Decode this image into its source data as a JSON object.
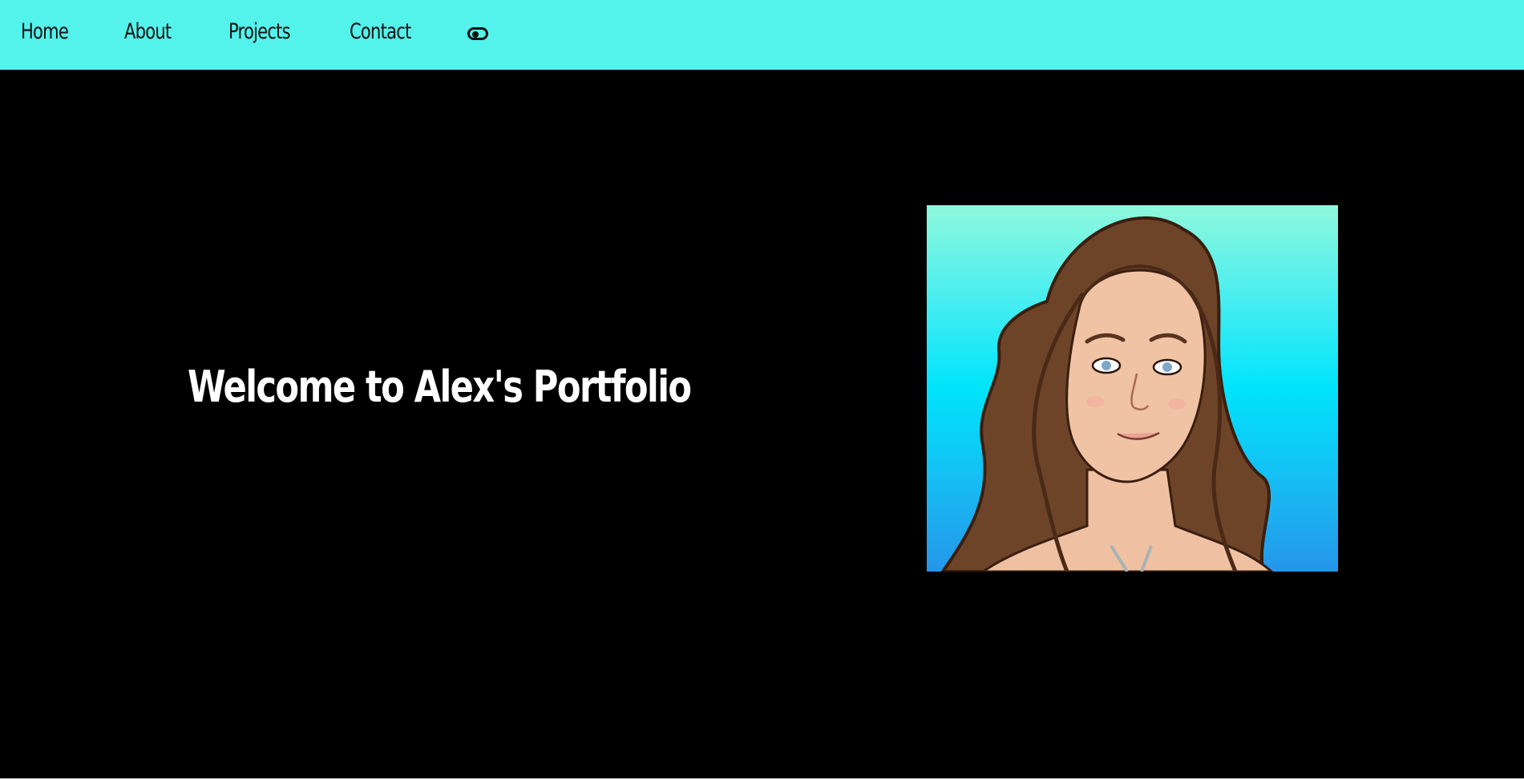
{
  "nav": {
    "items": [
      {
        "label": "Home"
      },
      {
        "label": "About"
      },
      {
        "label": "Projects"
      },
      {
        "label": "Contact"
      }
    ],
    "theme_toggle_icon": "toggle-icon"
  },
  "hero": {
    "title": "Welcome to Alex's Portfolio",
    "avatar_icon": "cartoon-avatar"
  },
  "colors": {
    "navbar_bg": "#53f2eb",
    "hero_bg": "#000000",
    "title_color": "#ffffff"
  }
}
